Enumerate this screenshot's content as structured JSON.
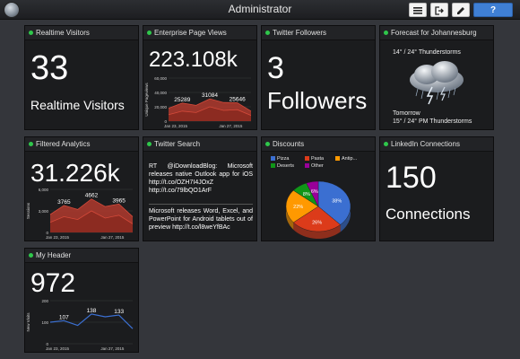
{
  "topbar": {
    "title": "Administrator",
    "buttons": [
      "menu-icon",
      "logout-icon",
      "edit-icon",
      "help-icon"
    ],
    "help_label": "?"
  },
  "tiles": {
    "realtime": {
      "title": "Realtime Visitors",
      "value": "33",
      "caption": "Realtime Visitors"
    },
    "enterprise": {
      "title": "Enterprise Page Views",
      "value": "223.108k"
    },
    "twitter_followers": {
      "title": "Twitter Followers",
      "value": "3",
      "caption": "Followers"
    },
    "forecast": {
      "title": "Forecast for Johannesburg",
      "today": "14° / 24° Thunderstorms",
      "tomorrow_label": "Tomorrow",
      "tomorrow": "15° / 24° PM Thunderstorms"
    },
    "filtered": {
      "title": "Filtered Analytics",
      "value": "31.226k"
    },
    "twitter_search": {
      "title": "Twitter Search",
      "tweet1": "RT @iDownloadBlog: Microsoft releases native Outlook app for iOS http://t.co/OZH7I4JOxZ http://t.co/79lbQO1ArF",
      "tweet2": "Microsoft releases Word, Excel, and PowerPoint for Android tablets out of preview http://t.co/l8weYfBAc"
    },
    "discounts": {
      "title": "Discounts"
    },
    "linkedin": {
      "title": "LinkedIn Connections",
      "value": "150",
      "caption": "Connections"
    },
    "myheader": {
      "title": "My Header",
      "value": "972"
    }
  },
  "chart_data": [
    {
      "type": "area",
      "ylabel": "Unique Pageviews",
      "x": [
        "Jan 23, 2015",
        "Jan 24, 2015",
        "Jan 25, 2015",
        "Jan 26, 2015",
        "Jan 27, 2015",
        "Jan 28, 2015",
        "Jan 29, 2015"
      ],
      "xticks": [
        "Jan 23, 2015",
        "Jan 27, 2015"
      ],
      "yticks": [
        "0",
        "20,000",
        "40,000",
        "60,000"
      ],
      "ylim": [
        0,
        60000
      ],
      "series": [
        {
          "values": [
            18000,
            25289,
            22000,
            31084,
            26000,
            25646,
            14000
          ],
          "color": "#b03a2e"
        },
        {
          "values": [
            9000,
            14000,
            12000,
            20000,
            15000,
            16000,
            8000
          ],
          "color": "#8b2a20"
        }
      ],
      "data_labels": [
        [
          "25289",
          1,
          25289
        ],
        [
          "31084",
          3,
          31084
        ],
        [
          "25646",
          5,
          25646
        ]
      ]
    },
    {
      "type": "area",
      "ylabel": "Sessions",
      "x": [
        "Jan 23, 2015",
        "Jan 24, 2015",
        "Jan 25, 2015",
        "Jan 26, 2015",
        "Jan 27, 2015",
        "Jan 28, 2015",
        "Jan 29, 2015"
      ],
      "xticks": [
        "Jan 23, 2015",
        "Jan 27, 2015"
      ],
      "yticks": [
        "0",
        "3,000",
        "6,000"
      ],
      "ylim": [
        0,
        6000
      ],
      "series": [
        {
          "values": [
            2500,
            3765,
            3200,
            4662,
            3600,
            3965,
            2200
          ],
          "color": "#b03a2e"
        },
        {
          "values": [
            1400,
            2200,
            1800,
            3000,
            2000,
            2400,
            1200
          ],
          "color": "#8b2a20"
        }
      ],
      "data_labels": [
        [
          "3765",
          1,
          3765
        ],
        [
          "4662",
          3,
          4662
        ],
        [
          "3965",
          5,
          3965
        ]
      ]
    },
    {
      "type": "pie",
      "legend": [
        "Pizza",
        "Pasta",
        "Antip...",
        "Deserts",
        "Other"
      ],
      "values": [
        38,
        26,
        22,
        8,
        6
      ],
      "labels": [
        "38%",
        "26%",
        "22%",
        "8%",
        "6%"
      ],
      "colors": [
        "#3b6fd1",
        "#dc3b1a",
        "#ff9900",
        "#109618",
        "#990099"
      ]
    },
    {
      "type": "line",
      "ylabel": "New Visits",
      "x": [
        "Jan 23, 2015",
        "Jan 24, 2015",
        "Jan 25, 2015",
        "Jan 26, 2015",
        "Jan 27, 2015",
        "Jan 28, 2015",
        "Jan 29, 2015"
      ],
      "xticks": [
        "Jan 23, 2015",
        "Jan 27, 2015"
      ],
      "yticks": [
        "0",
        "100",
        "200"
      ],
      "ylim": [
        0,
        200
      ],
      "series": [
        {
          "values": [
            100,
            107,
            85,
            138,
            125,
            133,
            70
          ],
          "color": "#3b6fd1"
        }
      ],
      "data_labels": [
        [
          "107",
          1,
          107
        ],
        [
          "138",
          3,
          138
        ],
        [
          "133",
          5,
          133
        ]
      ]
    }
  ]
}
